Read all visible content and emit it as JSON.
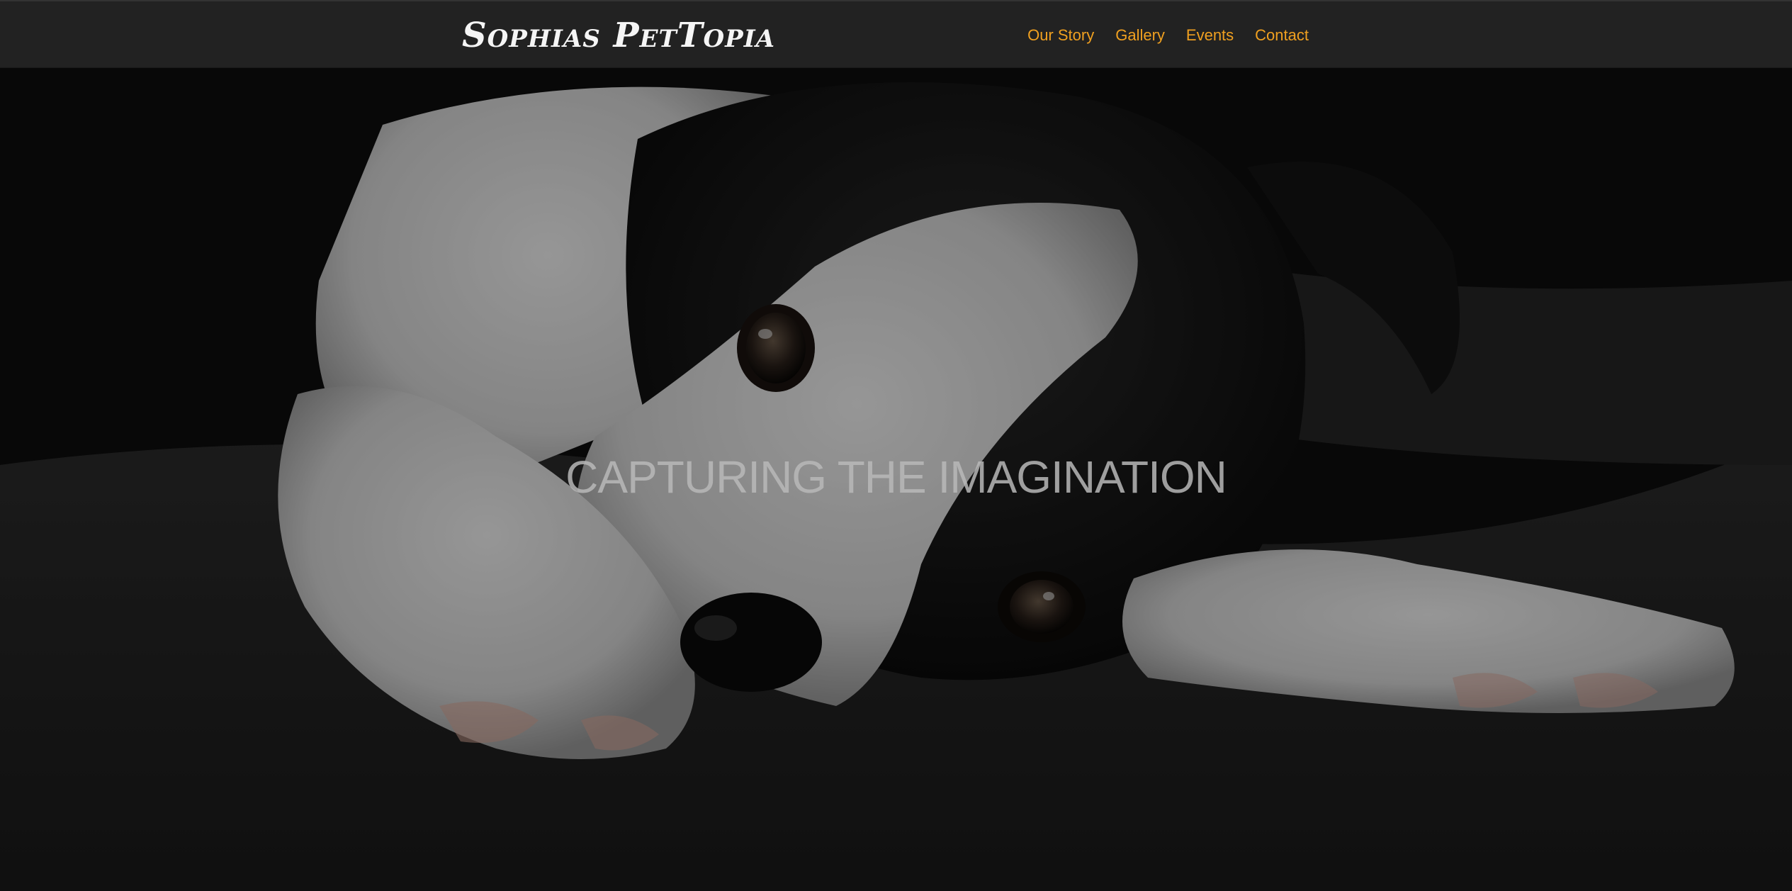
{
  "navbar": {
    "brand": "Sophias PetTopia",
    "links": [
      "Our Story",
      "Gallery",
      "Events",
      "Contact"
    ]
  },
  "hero": {
    "title": "CAPTURING THE IMAGINATION",
    "image_subject": "black and white puppy lying on a dark blanket"
  },
  "colors": {
    "navbar_bg": "#222222",
    "nav_link": "#f0a020",
    "brand_text": "#f5f5f5",
    "hero_title": "#b9b9b9"
  }
}
